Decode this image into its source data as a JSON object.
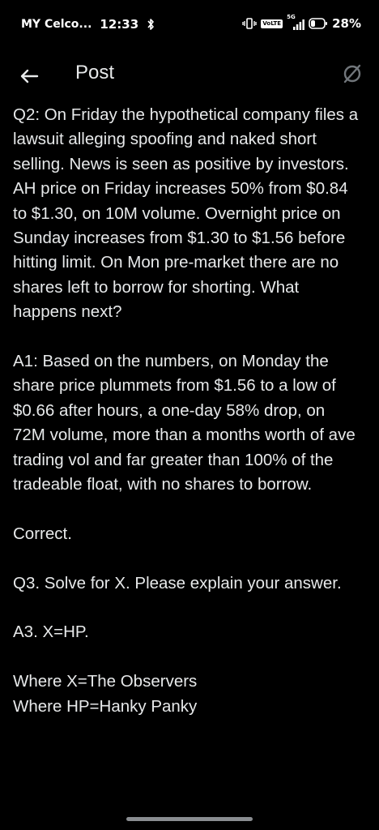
{
  "status_bar": {
    "carrier": "MY Celco...",
    "time": "12:33",
    "volte": "VoLTE",
    "network": "5G",
    "battery": "28%"
  },
  "header": {
    "title": "Post",
    "back_icon": "arrow-left-icon",
    "refresh_icon": "loading-spinner-icon"
  },
  "post": {
    "paragraphs": [
      "Q2: On Friday the hypothetical company files a lawsuit alleging spoofing and naked short selling. News is seen as positive by investors. AH price on Friday increases 50% from $0.84 to $1.30, on 10M volume. Overnight price on Sunday increases from $1.30 to $1.56 before hitting limit. On Mon pre-market there are no shares left to borrow for shorting. What happens next?",
      "A1: Based on the numbers, on Monday the share price plummets from $1.56 to a low of $0.66 after hours, a one-day 58% drop, on 72M volume, more than a months worth of ave trading vol and far greater than 100% of the tradeable float, with no shares to borrow.",
      "Correct.",
      "Q3. Solve for X. Please explain your answer.",
      "A3. X=HP.",
      "Where X=The Observers",
      "Where HP=Hanky Panky"
    ]
  },
  "colors": {
    "background": "#000000",
    "text": "#e7e9ea",
    "icon_muted": "#71767b"
  }
}
